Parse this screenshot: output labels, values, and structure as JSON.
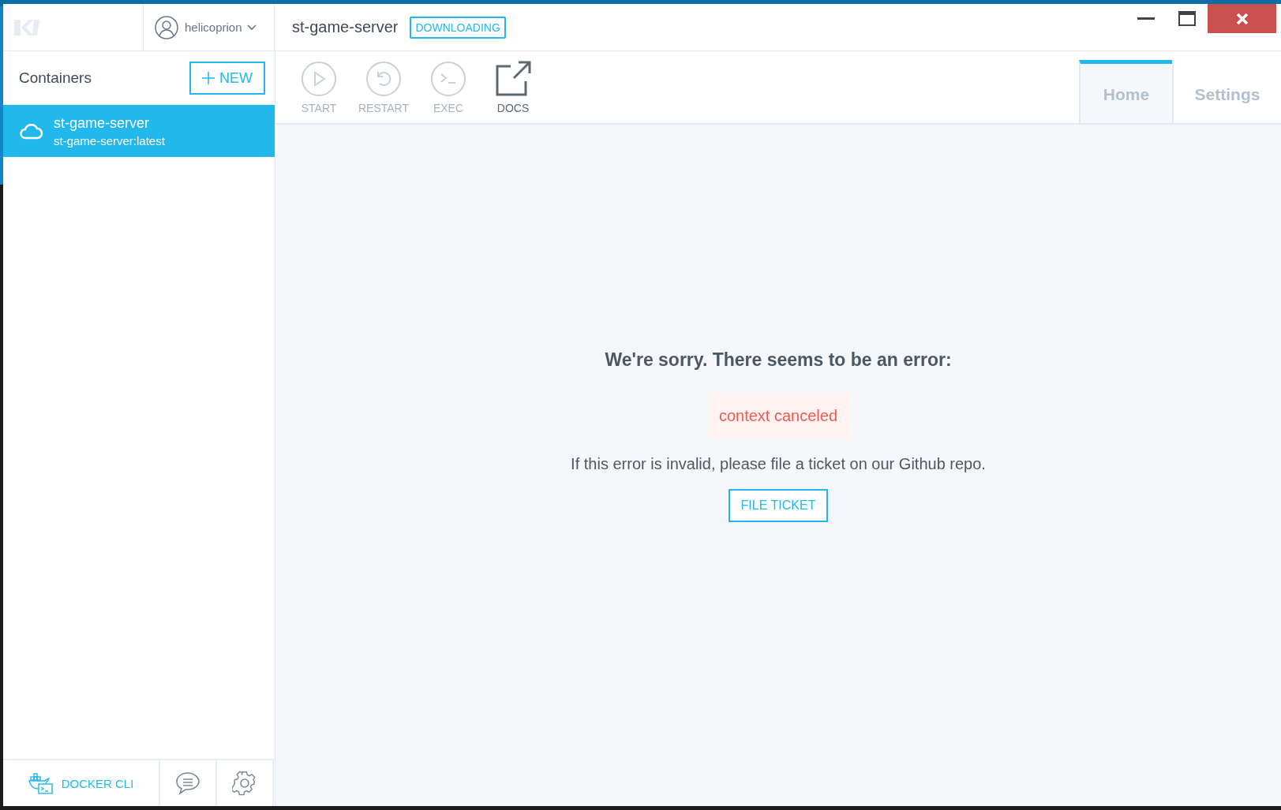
{
  "window": {
    "title": "st-game-server",
    "status_badge": "DOWNLOADING"
  },
  "account": {
    "username": "helicoprion"
  },
  "sidebar": {
    "heading": "Containers",
    "new_button": "NEW",
    "items": [
      {
        "name": "st-game-server",
        "image": "st-game-server:latest",
        "selected": true
      }
    ],
    "footer": {
      "cli_button": "DOCKER CLI"
    }
  },
  "toolbar": [
    {
      "kind": "start",
      "label": "START",
      "disabled": true
    },
    {
      "kind": "restart",
      "label": "RESTART",
      "disabled": true
    },
    {
      "kind": "exec",
      "label": "EXEC",
      "disabled": true
    },
    {
      "kind": "docs",
      "label": "DOCS",
      "disabled": false
    }
  ],
  "tabs": [
    {
      "label": "Home",
      "selected": true
    },
    {
      "label": "Settings",
      "selected": false
    }
  ],
  "error": {
    "heading": "We're sorry. There seems to be an error:",
    "message": "context canceled",
    "hint": "If this error is invalid, please file a ticket on our Github repo.",
    "button": "FILE TICKET"
  }
}
